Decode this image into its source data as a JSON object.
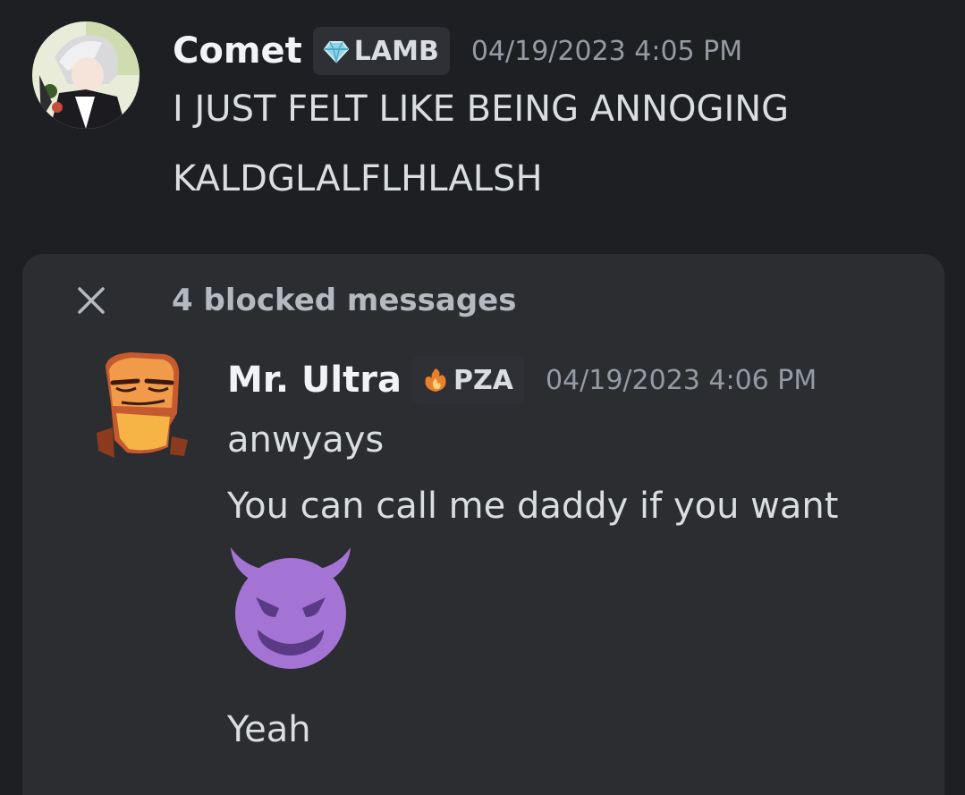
{
  "messages": [
    {
      "username": "Comet",
      "tag": "LAMB",
      "tag_icon": "diamond-gem-icon",
      "timestamp": "04/19/2023 4:05 PM",
      "lines": [
        "I JUST FELT LIKE BEING ANNOGING",
        "KALDGLALFLHLALSH"
      ]
    }
  ],
  "blocked": {
    "label": "4 blocked messages",
    "close_icon": "close-icon",
    "message": {
      "username": "Mr. Ultra",
      "tag": "PZA",
      "tag_icon": "flame-icon",
      "timestamp": "04/19/2023 4:06 PM",
      "lines": [
        "anwyays",
        "You can call me daddy if you want"
      ],
      "emoji": "smiling-devil-emoji",
      "after_emoji": "Yeah"
    }
  },
  "colors": {
    "background": "#1e1f22",
    "panel": "#2b2d31",
    "text": "#dbdee1",
    "muted": "#949ba4",
    "devil": "#a374d4"
  }
}
